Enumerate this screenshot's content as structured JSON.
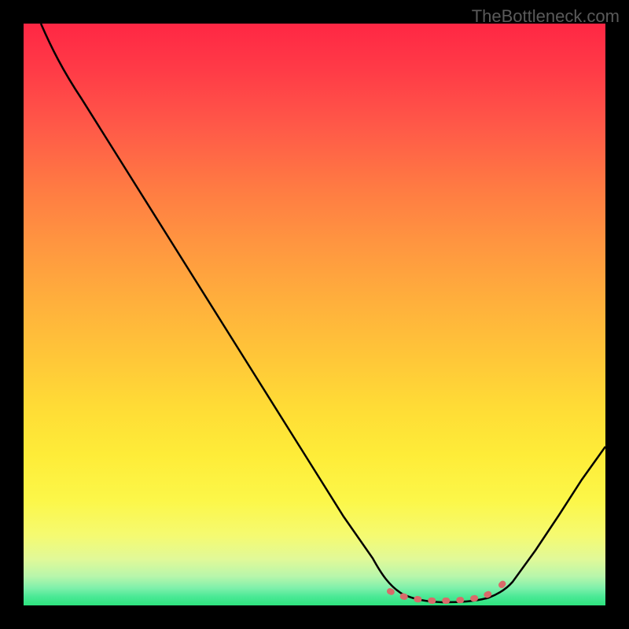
{
  "watermark": "TheBottleneck.com",
  "chart_data": {
    "type": "line",
    "title": "",
    "xlabel": "",
    "ylabel": "",
    "xlim": [
      0,
      100
    ],
    "ylim": [
      0,
      100
    ],
    "curve_points": [
      {
        "x": 3,
        "y": 100
      },
      {
        "x": 6,
        "y": 95
      },
      {
        "x": 10,
        "y": 89
      },
      {
        "x": 15,
        "y": 81
      },
      {
        "x": 20,
        "y": 73
      },
      {
        "x": 25,
        "y": 65
      },
      {
        "x": 30,
        "y": 57
      },
      {
        "x": 35,
        "y": 49
      },
      {
        "x": 40,
        "y": 41
      },
      {
        "x": 45,
        "y": 33
      },
      {
        "x": 50,
        "y": 25
      },
      {
        "x": 55,
        "y": 17
      },
      {
        "x": 60,
        "y": 9
      },
      {
        "x": 63,
        "y": 4
      },
      {
        "x": 65,
        "y": 2
      },
      {
        "x": 68,
        "y": 1
      },
      {
        "x": 72,
        "y": 0.5
      },
      {
        "x": 76,
        "y": 0.5
      },
      {
        "x": 80,
        "y": 1
      },
      {
        "x": 82,
        "y": 2
      },
      {
        "x": 84,
        "y": 3.5
      },
      {
        "x": 88,
        "y": 8
      },
      {
        "x": 92,
        "y": 14
      },
      {
        "x": 96,
        "y": 20
      },
      {
        "x": 100,
        "y": 26
      }
    ],
    "dotted_segment": {
      "start_x": 63,
      "end_x": 83,
      "y": 2
    },
    "gradient_colors": {
      "top": "#ff2744",
      "mid": "#ffd038",
      "bottom": "#2de37e"
    }
  }
}
